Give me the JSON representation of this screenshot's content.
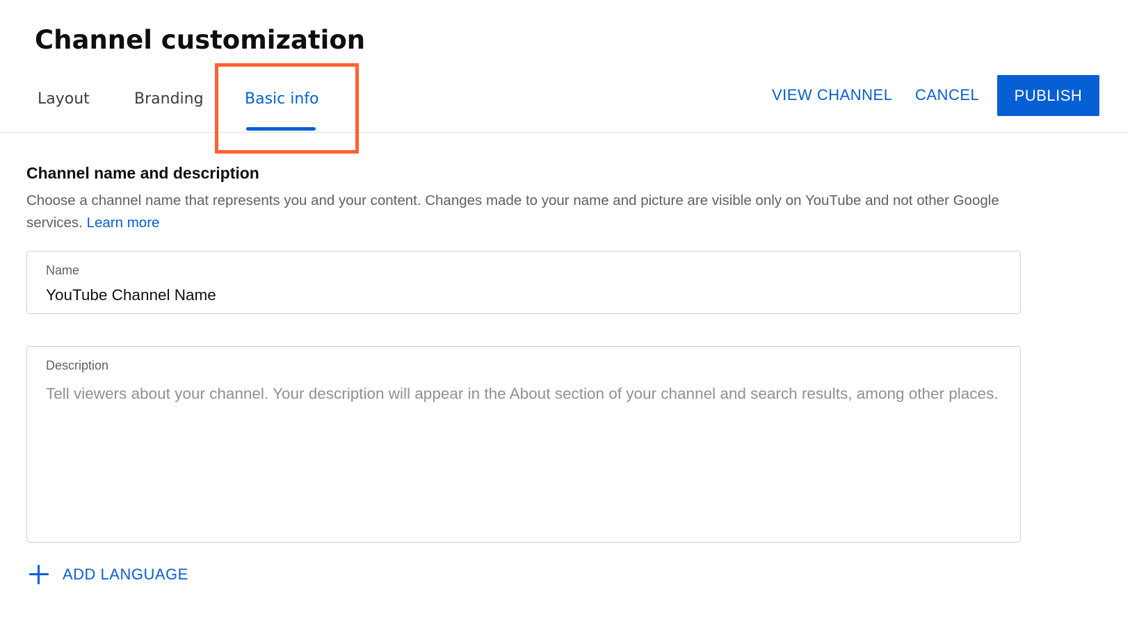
{
  "header": {
    "title": "Channel customization"
  },
  "tabs": [
    {
      "label": "Layout",
      "active": false
    },
    {
      "label": "Branding",
      "active": false
    },
    {
      "label": "Basic info",
      "active": true
    }
  ],
  "actions": {
    "view_channel": "VIEW CHANNEL",
    "cancel": "CANCEL",
    "publish": "PUBLISH"
  },
  "section": {
    "title": "Channel name and description",
    "description": "Choose a channel name that represents you and your content. Changes made to your name and picture are visible only on YouTube and not other Google services.",
    "learn_more": "Learn more"
  },
  "fields": {
    "name": {
      "label": "Name",
      "value": "YouTube Channel Name"
    },
    "description": {
      "label": "Description",
      "value": "",
      "placeholder": "Tell viewers about your channel. Your description will appear in the About section of your channel and search results, among other places."
    }
  },
  "add_language": {
    "label": "ADD LANGUAGE",
    "icon": "plus-icon"
  },
  "colors": {
    "accent": "#065fd4",
    "highlight": "#ff6230",
    "muted_text": "#606060",
    "border": "#cfcfcf"
  }
}
